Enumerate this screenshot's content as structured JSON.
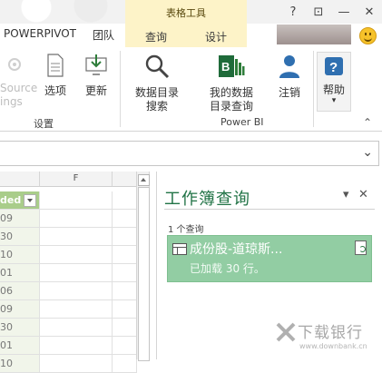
{
  "titlebar": {
    "context_group": "表格工具",
    "help": "?",
    "restore": "⊡",
    "minimize": "—",
    "close": "✕"
  },
  "tabs": {
    "powerpivot": "POWERPIVOT",
    "team": "团队",
    "query": "查询",
    "design": "设计"
  },
  "ribbon": {
    "faded_line1": "Source",
    "faded_line2": "ings",
    "options": "选项",
    "update": "更新",
    "settings_group": "设置",
    "search_catalog_1": "数据目录",
    "search_catalog_2": "搜索",
    "my_catalog_1": "我的数据",
    "my_catalog_2": "目录查询",
    "signout": "注销",
    "powerbi_group": "Power BI",
    "help": "帮助",
    "help_arrow": "▾",
    "collapse": "⌃"
  },
  "formula_bar": {
    "chevron": "⌄"
  },
  "sheet": {
    "column_f": "F",
    "header_cell": "ded",
    "rows": [
      "09",
      "30",
      "10",
      "01",
      "06",
      "09",
      "30",
      "01",
      "10"
    ]
  },
  "pane": {
    "title": "工作簿查询",
    "dropdown": "▾",
    "close": "✕",
    "count": "1 个查询",
    "query_name": "成份股-道琼斯...",
    "query_status": "已加载 30 行。"
  },
  "watermark": {
    "brand": "下载银行",
    "url": "www.downbank.cn"
  },
  "colors": {
    "accent_green": "#217346",
    "query_bg": "#92cda3",
    "context_yellow": "#fdf3c8",
    "table_header": "#a9cd8a"
  }
}
